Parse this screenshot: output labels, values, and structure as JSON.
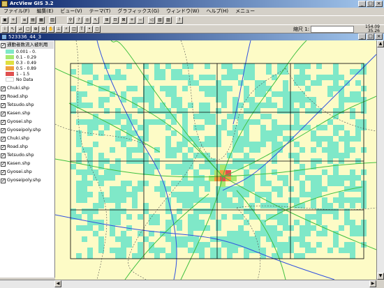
{
  "app": {
    "title": "ArcView GIS 3.2"
  },
  "menu": [
    "ファイル(F)",
    "編集(E)",
    "ビュー(V)",
    "テーマ(T)",
    "グラフィックス(G)",
    "ウィンドウ(W)",
    "ヘルプ(H)",
    "メニュー"
  ],
  "toolbar": {
    "scale_label": "縮尺 1:",
    "scale_value": "",
    "coord_x": "154.09",
    "coord_y": "35.26"
  },
  "view": {
    "title": "523336_44_3",
    "legend_title": "通勤者数流入被利用",
    "legend": [
      {
        "label": "0.001 - 0.",
        "color": "#7fe8c8"
      },
      {
        "label": "0.1 - 0.29",
        "color": "#a8e870"
      },
      {
        "label": "0.3 - 0.49",
        "color": "#e0e040"
      },
      {
        "label": "0.5 - 0.89",
        "color": "#f0a040"
      },
      {
        "label": "1 - 1.5",
        "color": "#e05050"
      },
      {
        "label": "No Data",
        "color": "#ffffff"
      }
    ],
    "themes": [
      "Chuki.shp",
      "Road.shp",
      "Tetsudo.shp",
      "Kasen.shp",
      "Gyosei.shp",
      "Gyoseipoly.shp",
      "Chuki.shp",
      "Road.shp",
      "Tetsudo.shp",
      "Kasen.shp",
      "Gyosei.shp",
      "Gyoseipoly.shp"
    ]
  },
  "colors": {
    "map_bg": "#fdfbc6",
    "cell": "#7fe8c8",
    "hot": "#e05050",
    "mid": "#f0a040",
    "green": "#a8e870",
    "road": "#40c040",
    "river": "#3050e0",
    "boundary": "#404040"
  }
}
